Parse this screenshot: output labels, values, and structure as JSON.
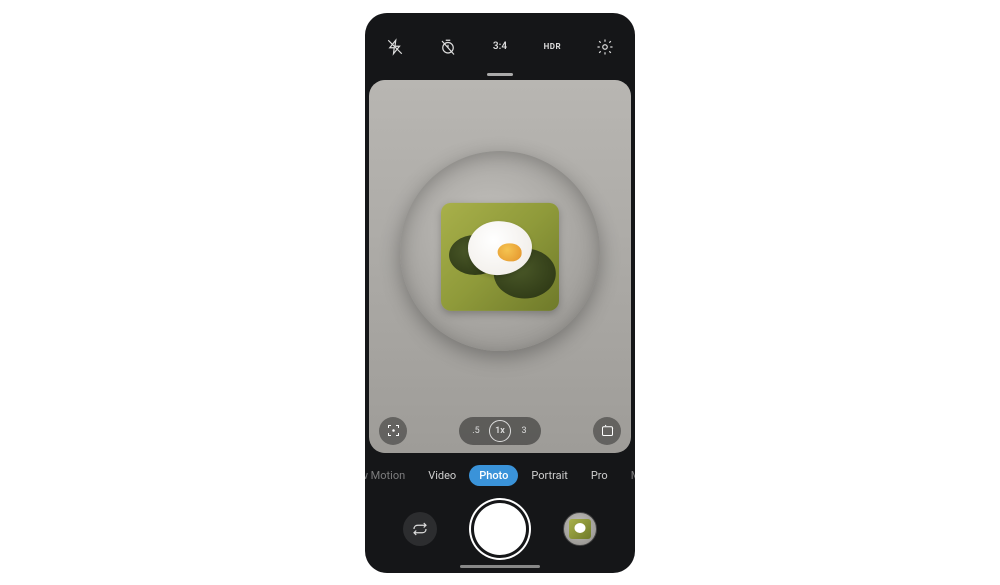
{
  "topbar": {
    "flash_icon": "flash-off",
    "timer_icon": "timer-off",
    "ratio_label": "3:4",
    "hdr_label": "HDR",
    "settings_icon": "gear"
  },
  "viewfinder": {
    "scan_icon": "qr-scan",
    "effects_icon": "effects",
    "subject": "avocado toast with poached egg on grey plate"
  },
  "zoom": {
    "options": [
      ".5",
      "1x",
      "3"
    ],
    "active_index": 1
  },
  "modes": {
    "items": [
      "w Motion",
      "Video",
      "Photo",
      "Portrait",
      "Pro",
      "M"
    ],
    "active_index": 2
  },
  "bottombar": {
    "switch_icon": "camera-switch",
    "shutter": "shutter",
    "thumbnail": "last-photo"
  }
}
